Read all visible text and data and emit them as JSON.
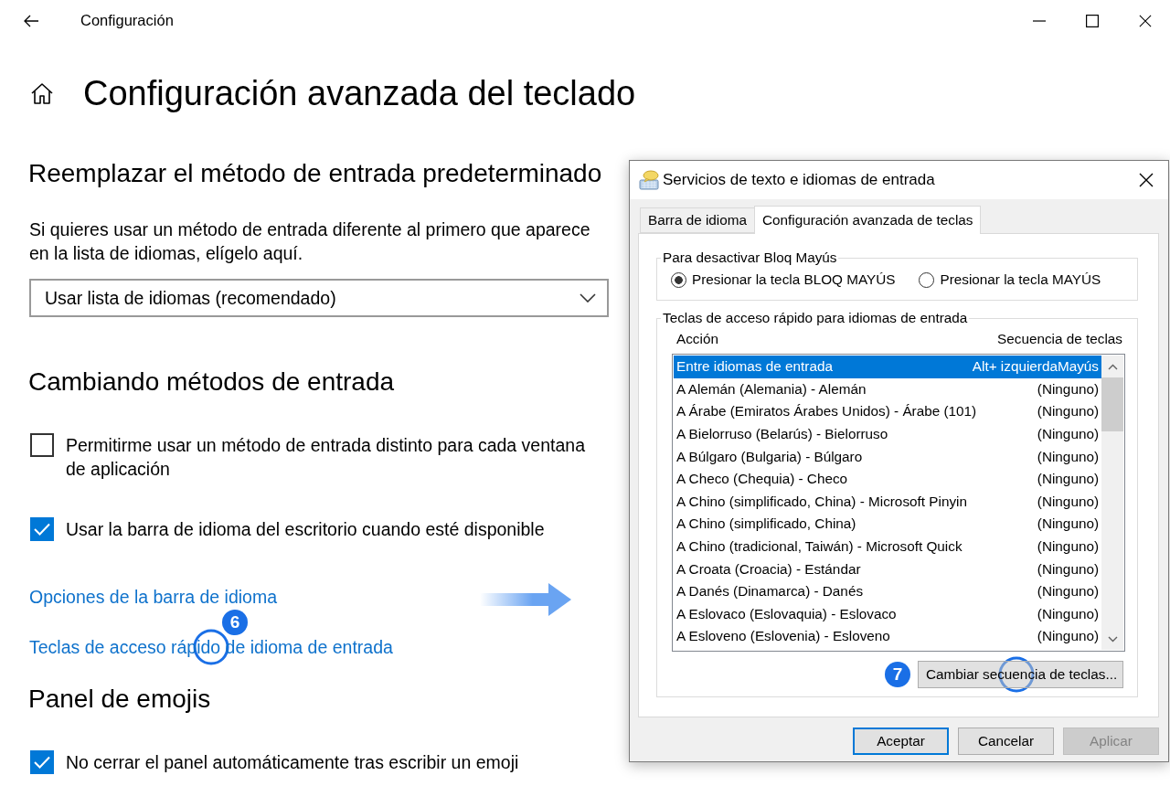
{
  "window": {
    "title": "Configuración"
  },
  "page": {
    "title": "Configuración avanzada del teclado"
  },
  "sections": [
    {
      "kind": "dropdown",
      "heading": "Reemplazar el método de entrada predeterminado",
      "description": "Si quieres usar un método de entrada diferente al primero que aparece en la lista de idiomas, elígelo aquí.",
      "dropdown": {
        "value": "Usar lista de idiomas (recomendado)"
      }
    },
    {
      "kind": "options",
      "heading": "Cambiando métodos de entrada",
      "checkboxes": [
        {
          "label": "Permitirme usar un método de entrada distinto para cada ventana de aplicación",
          "checked": false
        },
        {
          "label": "Usar la barra de idioma del escritorio cuando esté disponible",
          "checked": true
        }
      ],
      "links": [
        {
          "label": "Opciones de la barra de idioma"
        },
        {
          "label": "Teclas de acceso rápido de idioma de entrada",
          "callout": "6"
        }
      ]
    },
    {
      "kind": "options",
      "heading": "Panel de emojis",
      "checkboxes": [
        {
          "label": "No cerrar el panel automáticamente tras escribir un emoji",
          "checked": true
        }
      ]
    }
  ],
  "dialog": {
    "title": "Servicios de texto e idiomas de entrada",
    "tabs": [
      {
        "label": "Barra de idioma",
        "selected": false
      },
      {
        "label": "Configuración avanzada de teclas",
        "selected": true
      }
    ],
    "caps_group": {
      "title": "Para desactivar Bloq Mayús",
      "options": [
        {
          "label": "Presionar la tecla BLOQ MAYÚS",
          "selected": true
        },
        {
          "label": "Presionar la tecla MAYÚS",
          "selected": false
        }
      ]
    },
    "hotkeys_group": {
      "title": "Teclas de acceso rápido para idiomas de entrada",
      "columns": [
        "Acción",
        "Secuencia de teclas"
      ],
      "rows": [
        {
          "action": "Entre idiomas de entrada",
          "keys": "Alt+ izquierdaMayús",
          "selected": true
        },
        {
          "action": "A Alemán (Alemania) - Alemán",
          "keys": "(Ninguno)",
          "selected": false
        },
        {
          "action": "A Árabe (Emiratos Árabes Unidos) - Árabe (101)",
          "keys": "(Ninguno)",
          "selected": false
        },
        {
          "action": "A Bielorruso (Belarús) - Bielorruso",
          "keys": "(Ninguno)",
          "selected": false
        },
        {
          "action": "A Búlgaro (Bulgaria) - Búlgaro",
          "keys": "(Ninguno)",
          "selected": false
        },
        {
          "action": "A Checo (Chequia) - Checo",
          "keys": "(Ninguno)",
          "selected": false
        },
        {
          "action": "A Chino (simplificado, China) - Microsoft Pinyin",
          "keys": "(Ninguno)",
          "selected": false
        },
        {
          "action": "A Chino (simplificado, China)",
          "keys": "(Ninguno)",
          "selected": false
        },
        {
          "action": "A Chino (tradicional, Taiwán) - Microsoft Quick",
          "keys": "(Ninguno)",
          "selected": false
        },
        {
          "action": "A Croata (Croacia) - Estándar",
          "keys": "(Ninguno)",
          "selected": false
        },
        {
          "action": "A Danés (Dinamarca) - Danés",
          "keys": "(Ninguno)",
          "selected": false
        },
        {
          "action": "A Eslovaco (Eslovaquia) - Eslovaco",
          "keys": "(Ninguno)",
          "selected": false
        },
        {
          "action": "A Esloveno (Eslovenia) - Esloveno",
          "keys": "(Ninguno)",
          "selected": false
        }
      ],
      "button": {
        "label": "Cambiar secuencia de teclas...",
        "callout": "7"
      }
    },
    "buttons": [
      {
        "label": "Aceptar",
        "default": true,
        "disabled": false
      },
      {
        "label": "Cancelar",
        "default": false,
        "disabled": false
      },
      {
        "label": "Aplicar",
        "default": false,
        "disabled": true
      }
    ]
  }
}
